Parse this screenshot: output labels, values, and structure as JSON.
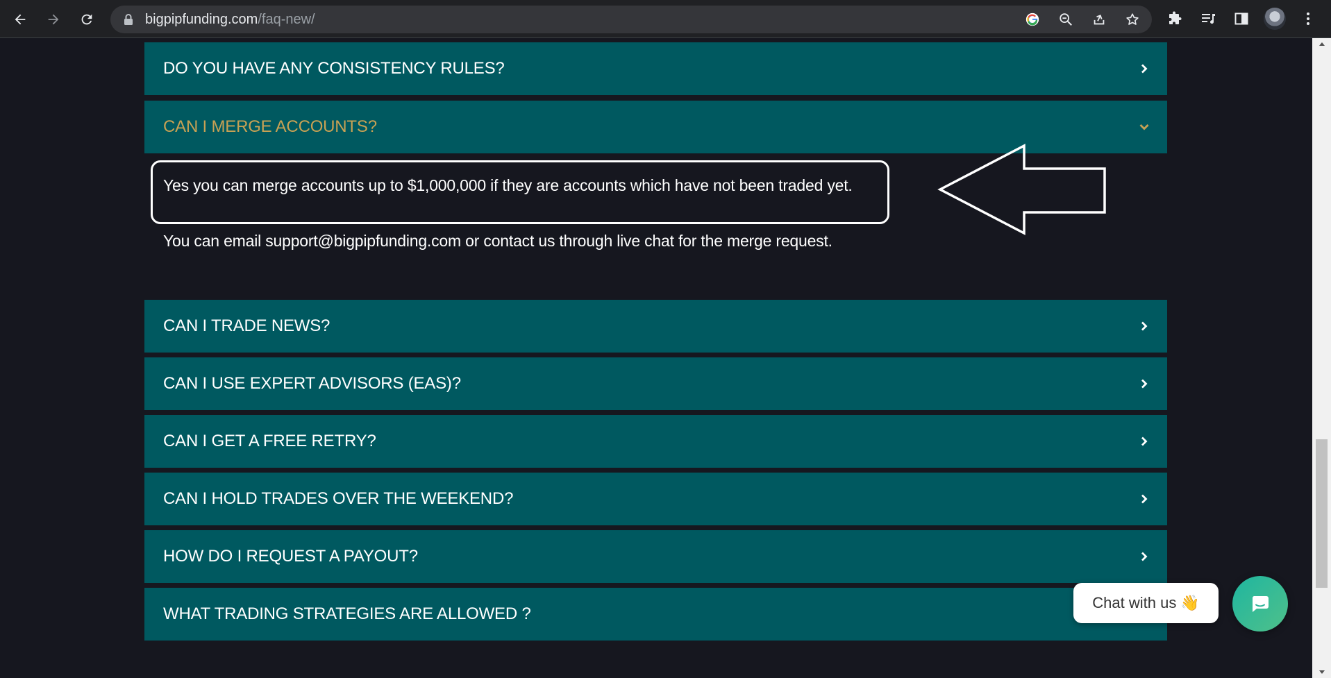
{
  "browser": {
    "url_host": "bigpipfunding.com",
    "url_path": "/faq-new/"
  },
  "faq": {
    "items": [
      {
        "question": "DO YOU HAVE ANY CONSISTENCY RULES?",
        "expanded": false
      },
      {
        "question": "CAN I MERGE ACCOUNTS?",
        "expanded": true
      },
      {
        "question": "CAN I TRADE NEWS?",
        "expanded": false
      },
      {
        "question": "CAN I USE EXPERT ADVISORS (EAS)?",
        "expanded": false
      },
      {
        "question": "CAN I GET A FREE RETRY?",
        "expanded": false
      },
      {
        "question": "CAN I HOLD TRADES OVER THE WEEKEND?",
        "expanded": false
      },
      {
        "question": "HOW DO I REQUEST A PAYOUT?",
        "expanded": false
      },
      {
        "question": "WHAT TRADING STRATEGIES ARE ALLOWED ?",
        "expanded": false
      }
    ],
    "answer": {
      "paragraph_1": "Yes you can merge accounts up to $1,000,000 if they are accounts which have not been traded yet.",
      "paragraph_2": "You can email support@bigpipfunding.com or contact us through live chat for the merge request."
    }
  },
  "chat": {
    "pill_label": "Chat with us",
    "pill_emoji": "👋"
  },
  "colors": {
    "accordion_bg": "#005960",
    "active_question": "#c7a154",
    "page_bg": "#16171f"
  }
}
